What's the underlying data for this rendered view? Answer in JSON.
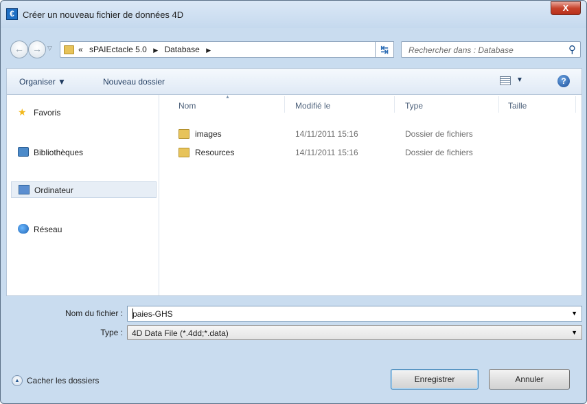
{
  "window": {
    "title": "Créer un nouveau fichier de données 4D",
    "app_icon_glyph": "€",
    "close_glyph": "X"
  },
  "address": {
    "overflow": "«",
    "crumbs": [
      "sPAIEctacle 5.0",
      "Database"
    ],
    "search_placeholder": "Rechercher dans : Database"
  },
  "toolbar": {
    "organize": "Organiser ▼",
    "new_folder": "Nouveau dossier"
  },
  "sidebar": {
    "items": [
      {
        "label": "Favoris",
        "icon": "star-icon"
      },
      {
        "label": "Bibliothèques",
        "icon": "library-icon"
      },
      {
        "label": "Ordinateur",
        "icon": "computer-icon",
        "selected": true
      },
      {
        "label": "Réseau",
        "icon": "network-icon"
      }
    ]
  },
  "columns": [
    "Nom",
    "Modifié le",
    "Type",
    "Taille"
  ],
  "files": [
    {
      "name": "images",
      "modified": "14/11/2011 15:16",
      "type": "Dossier de fichiers",
      "size": ""
    },
    {
      "name": "Resources",
      "modified": "14/11/2011 15:16",
      "type": "Dossier de fichiers",
      "size": ""
    }
  ],
  "form": {
    "filename_label": "Nom du fichier :",
    "filename_value": "paies-GHS",
    "type_label": "Type :",
    "type_value": "4D Data File (*.4dd;*.data)"
  },
  "footer": {
    "hide_folders": "Cacher les dossiers",
    "save": "Enregistrer",
    "cancel": "Annuler"
  }
}
